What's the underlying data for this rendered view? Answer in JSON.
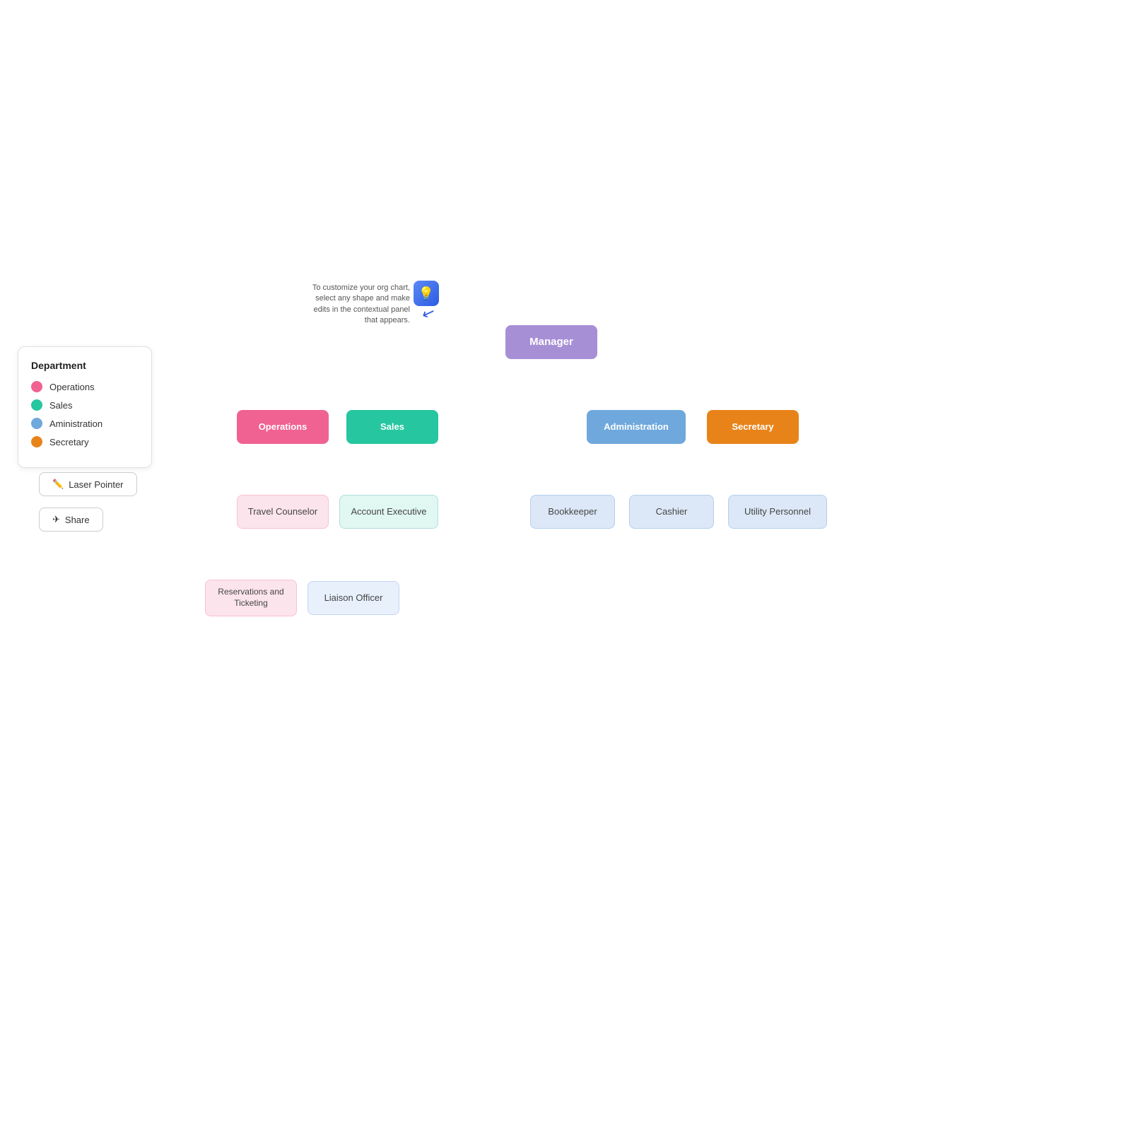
{
  "legend": {
    "title": "Department",
    "items": [
      {
        "label": "Operations",
        "color": "#f06292"
      },
      {
        "label": "Sales",
        "color": "#26c6a0"
      },
      {
        "label": "Aministration",
        "color": "#6fa8dc"
      },
      {
        "label": "Secretary",
        "color": "#e8831a"
      }
    ]
  },
  "buttons": {
    "laser_pointer": "Laser Pointer",
    "share": "Share"
  },
  "tooltip": {
    "text": "To customize your org chart, select any shape and make edits in the contextual panel that appears."
  },
  "nodes": {
    "manager": "Manager",
    "operations": "Operations",
    "sales": "Sales",
    "administration": "Administration",
    "secretary": "Secretary",
    "travel_counselor": "Travel Counselor",
    "account_executive": "Account Executive",
    "bookkeeper": "Bookkeeper",
    "cashier": "Cashier",
    "utility_personnel": "Utility Personnel",
    "reservations_ticketing": "Reservations and Ticketing",
    "liaison_officer": "Liaison Officer"
  }
}
